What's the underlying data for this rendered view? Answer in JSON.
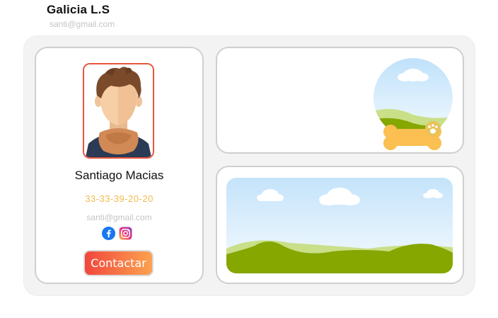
{
  "brand": {
    "title": "Galicia L.S",
    "email": "santi@gmail.com"
  },
  "profile": {
    "name": "Santiago Macias",
    "phone": "33-33-39-20-20",
    "email": "santi@gmail.com",
    "contact_label": "Contactar",
    "socials": [
      {
        "name": "facebook",
        "icon": "facebook-icon"
      },
      {
        "name": "instagram",
        "icon": "instagram-icon"
      }
    ]
  },
  "colors": {
    "accent": "#e8553e",
    "phone": "#f2b94d",
    "button_start": "#f2453d",
    "button_end": "#fda24f",
    "facebook": "#1877f2",
    "sky": "#cfe9fb",
    "hill": "#86a600",
    "bone": "#fbbf52"
  }
}
